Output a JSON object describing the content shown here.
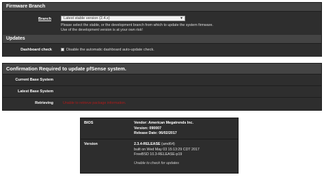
{
  "firmware_branch": {
    "title": "Firmware Branch",
    "branch_label": "Branch",
    "select_value": "Latest stable version (2.4.x)",
    "help_line1": "Please select the stable, or the development branch from which to update the system firmware.",
    "help_line2": "Use of the development version is at your own risk!"
  },
  "updates": {
    "title": "Updates",
    "dashboard_label": "Dashboard check",
    "checkbox_label": "Disable the automatic dashboard auto-update check."
  },
  "confirmation": {
    "title": "Confirmation Required to update pfSense system.",
    "current_label": "Current Base System",
    "latest_label": "Latest Base System",
    "retrieving_label": "Retrieving",
    "retrieving_status": "Unable to retrieve package information."
  },
  "system_info": {
    "bios_label": "BIOS",
    "bios_vendor": "Vendor: American Megatrends Inc.",
    "bios_version": "Version: 090007",
    "bios_release": "Release Date: 06/02/2017",
    "version_label": "Version",
    "version_main": "2.3.4-RELEASE",
    "version_arch": " (amd64)",
    "version_built": "built on Wed May 03 15:13:29 CDT 2017",
    "version_freebsd": "FreeBSD 10.3-RELEASE-p19",
    "version_status": "Unable to check for updates"
  },
  "colors": {
    "panel_bg": "#2b2b2b",
    "header_bg": "#444444",
    "status_red": "#b11b1b"
  }
}
